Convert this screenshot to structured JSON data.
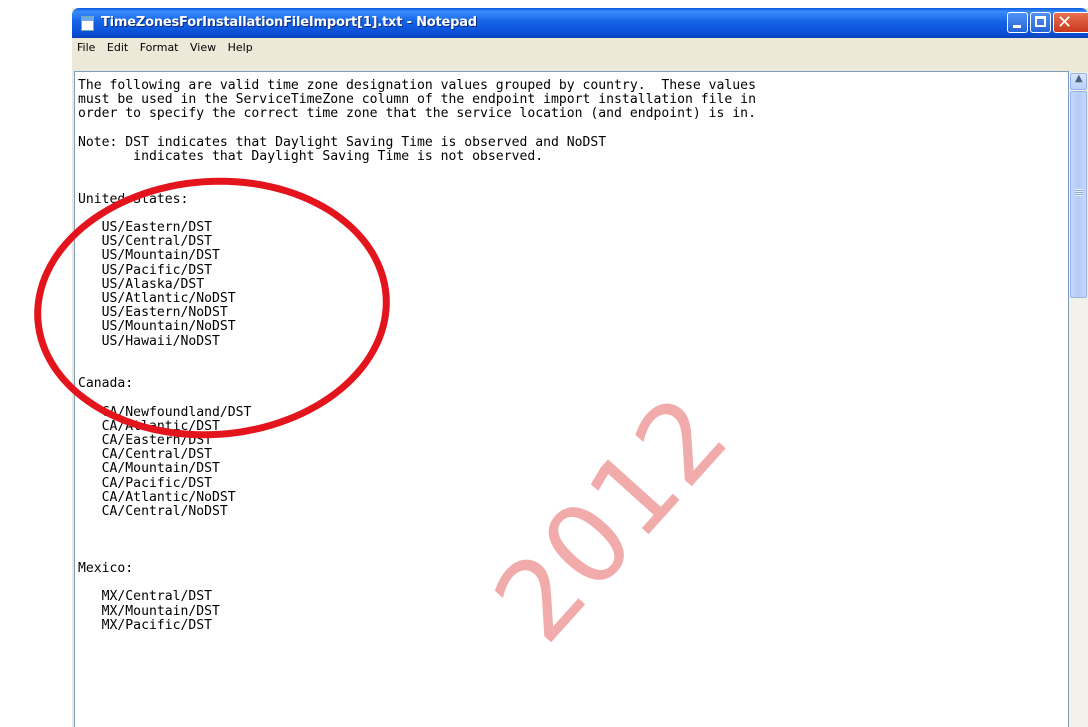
{
  "window": {
    "title": "TimeZonesForInstallationFileImport[1].txt - Notepad"
  },
  "menu": [
    "File",
    "Edit",
    "Format",
    "View",
    "Help"
  ],
  "document": {
    "text": "The following are valid time zone designation values grouped by country.  These values\nmust be used in the ServiceTimeZone column of the endpoint import installation file in\norder to specify the correct time zone that the service location (and endpoint) is in.\n\nNote: DST indicates that Daylight Saving Time is observed and NoDST\n       indicates that Daylight Saving Time is not observed.\n\n\nUnited States:\n\n   US/Eastern/DST\n   US/Central/DST\n   US/Mountain/DST\n   US/Pacific/DST\n   US/Alaska/DST\n   US/Atlantic/NoDST\n   US/Eastern/NoDST\n   US/Mountain/NoDST\n   US/Hawaii/NoDST\n\n\nCanada:\n\n   CA/Newfoundland/DST\n   CA/Atlantic/DST\n   CA/Eastern/DST\n   CA/Central/DST\n   CA/Mountain/DST\n   CA/Pacific/DST\n   CA/Atlantic/NoDST\n   CA/Central/NoDST\n\n\n\nMexico:\n\n   MX/Central/DST\n   MX/Mountain/DST\n   MX/Pacific/DST"
  },
  "watermark": "2012",
  "colors": {
    "titlebar": "#0a5ae0",
    "annotation": "#e4141c",
    "watermark": "#f0a3a3"
  }
}
